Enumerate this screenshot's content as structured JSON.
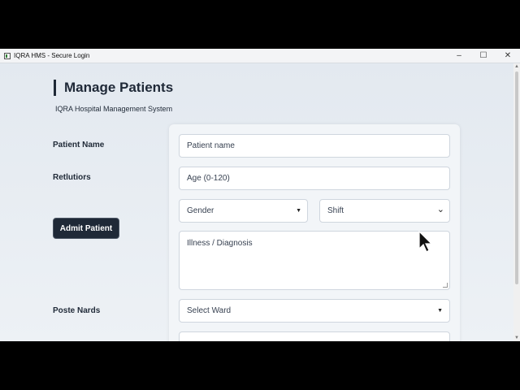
{
  "window": {
    "title": "IQRA HMS - Secure Login",
    "minimize": "–",
    "maximize": "☐",
    "close": "✕"
  },
  "header": {
    "title": "Manage Patients",
    "subtitle": "IQRA Hospital Management System"
  },
  "labels": {
    "patient_name": "Patient Name",
    "retlutiors": "Retlutiors",
    "poste_nards": "Poste Nards"
  },
  "buttons": {
    "admit": "Admit Patient"
  },
  "form": {
    "patient_name_placeholder": "Patient name",
    "age_placeholder": "Age (0-120)",
    "gender_value": "Gender",
    "shift_value": "Shift",
    "illness_placeholder": "Illness / Diagnosis",
    "ward_value": "Select Ward"
  },
  "icons": {
    "caret": "▼",
    "chevron": "⌄"
  },
  "colors": {
    "primary": "#1f2937",
    "background": "#e9eef4"
  }
}
